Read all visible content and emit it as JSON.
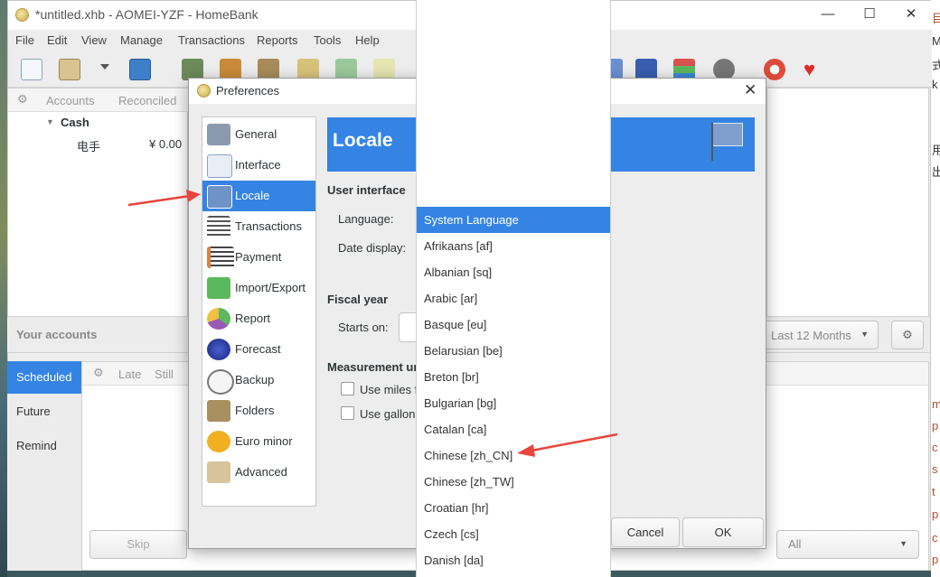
{
  "window": {
    "title": "*untitled.xhb - AOMEI-YZF - HomeBank",
    "controls": {
      "minimize": "—",
      "maximize": "☐",
      "close": "✕"
    }
  },
  "menu": [
    "File",
    "Edit",
    "View",
    "Manage",
    "Transactions",
    "Reports",
    "Tools",
    "Help"
  ],
  "accounts": {
    "columns": [
      "Accounts",
      "Reconciled"
    ],
    "group": "Cash",
    "rows": [
      {
        "name": "电手",
        "value": "¥ 0.00"
      }
    ],
    "footer": "Your accounts"
  },
  "summary": {
    "period": "Last 12 Months"
  },
  "scheduled": {
    "tabs": [
      "Scheduled",
      "Future",
      "Remind"
    ],
    "columns": [
      "Late",
      "Still"
    ],
    "skip": "Skip",
    "filter": "All"
  },
  "dialog": {
    "title": "Preferences",
    "nav": [
      "General",
      "Interface",
      "Locale",
      "Transactions",
      "Payment",
      "Import/Export",
      "Report",
      "Forecast",
      "Backup",
      "Folders",
      "Euro minor",
      "Advanced"
    ],
    "selected": "Locale",
    "page_title": "Locale",
    "user_interface": "User interface",
    "language_label": "Language:",
    "date_display_label": "Date display:",
    "fiscal_year": "Fiscal year",
    "starts_on": "Starts on:",
    "measurement": "Measurement ur",
    "use_miles": "Use miles f",
    "use_gallon": "Use gallon",
    "cancel": "Cancel",
    "ok": "OK"
  },
  "dropdown": {
    "options": [
      "System Language",
      "Afrikaans [af]",
      "Albanian [sq]",
      "Arabic [ar]",
      "Basque [eu]",
      "Belarusian [be]",
      "Breton [br]",
      "Bulgarian [bg]",
      "Catalan [ca]",
      "Chinese [zh_CN]",
      "Chinese [zh_TW]",
      "Croatian [hr]",
      "Czech [cs]",
      "Danish [da]"
    ],
    "selected": "System Language"
  },
  "desktop_right": [
    "目",
    "M",
    "式",
    "k",
    "用",
    "出",
    "m",
    "p",
    "c",
    "s",
    "t",
    "p",
    "c",
    "p"
  ],
  "colors": {
    "accent": "#3584e4",
    "arrow": "#e8453c"
  }
}
